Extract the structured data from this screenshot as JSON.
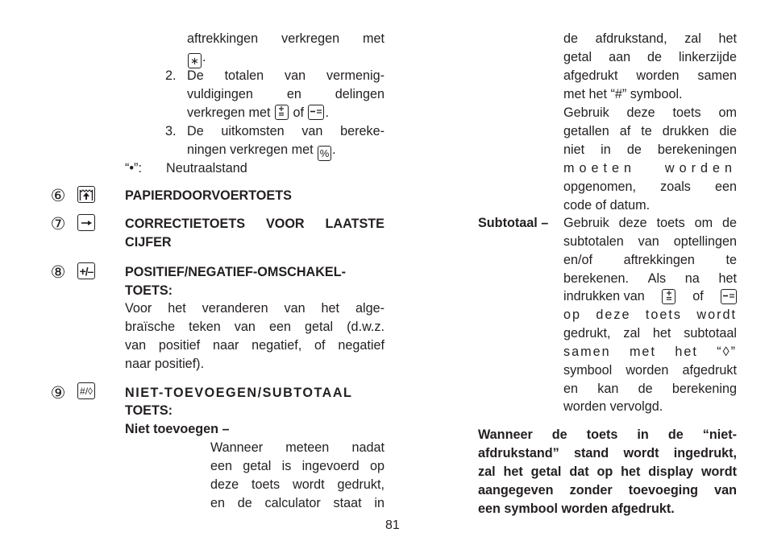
{
  "page_number": "81",
  "left_column": {
    "intro_lines": {
      "l1": "aftrekkingen verkregen met",
      "l1_key": "∗",
      "l1_end": ".",
      "item2_num": "2.",
      "item2_l1": "De totalen van vermenig-",
      "item2_l2": "vuldigingen en delingen",
      "item2_l3_pre": "verkregen met",
      "item2_l3_mid": "of",
      "item2_l3_end": ".",
      "item3_num": "3.",
      "item3_l1": "De uitkomsten van bereke-",
      "item3_l2_pre": "ningen verkregen met",
      "item3_key": "%",
      "item3_l2_end": ".",
      "neutral_label": "“•”:",
      "neutral_text": "Neutraalstand"
    },
    "sections": [
      {
        "number": "⑥",
        "key_icon": "paper-feed-icon",
        "heading": [
          "PAPIERDOORVOERTOETS"
        ]
      },
      {
        "number": "⑦",
        "key_icon": "arrow-right-icon",
        "heading": [
          "CORRECTIETOETS VOOR LAATSTE",
          "CIJFER"
        ]
      },
      {
        "number": "⑧",
        "key_icon": "plus-minus-icon",
        "key_label": "+/–",
        "heading": [
          "POSITIEF/NEGATIEF-OMSCHAKEL-",
          "TOETS:"
        ],
        "body": [
          "Voor het veranderen van het alge-",
          "braïsche teken van een getal (d.w.z.",
          "van positief naar negatief, of negatief",
          "naar positief)."
        ]
      },
      {
        "number": "⑨",
        "key_icon": "non-add-subtotal-icon",
        "key_label": "#/◊",
        "heading": [
          "NIET-TOEVOEGEN/SUBTOTAAL",
          "TOETS:"
        ],
        "subheading": "Niet toevoegen –",
        "body": [
          "Wanneer meteen nadat",
          "een getal is ingevoerd op",
          "deze toets wordt gedrukt,",
          "en de calculator staat in"
        ]
      }
    ]
  },
  "right_column": {
    "continuation": [
      "de afdrukstand, zal het",
      "getal aan de linkerzijde",
      "afgedrukt worden samen",
      "met het “#” symbool.",
      "Gebruik deze toets om",
      "getallen af te drukken die",
      "niet in de berekeningen",
      "moeten worden",
      "opgenomen, zoals een",
      "code of datum."
    ],
    "subtotaal_label": "Subtotaal –",
    "subtotaal_body": {
      "l1": "Gebruik deze toets om de",
      "l2": "subtotalen van optellingen",
      "l3": "en/of aftrekkingen te",
      "l4": "berekenen. Als na het",
      "l5_pre": "indrukken van",
      "l5_mid": "of",
      "l6": "op deze toets wordt",
      "l7": "gedrukt, zal het subtotaal",
      "l8": "samen met het “◊”",
      "l9": "symbool worden afgedrukt",
      "l10": "en kan de berekening",
      "l11": "worden vervolgd."
    },
    "note": [
      "Wanneer de toets in de “niet-",
      "afdrukstand” stand wordt ingedrukt,",
      "zal het getal dat op het display wordt",
      "aangegeven zonder toevoeging van",
      "een symbool worden afgedrukt."
    ]
  }
}
